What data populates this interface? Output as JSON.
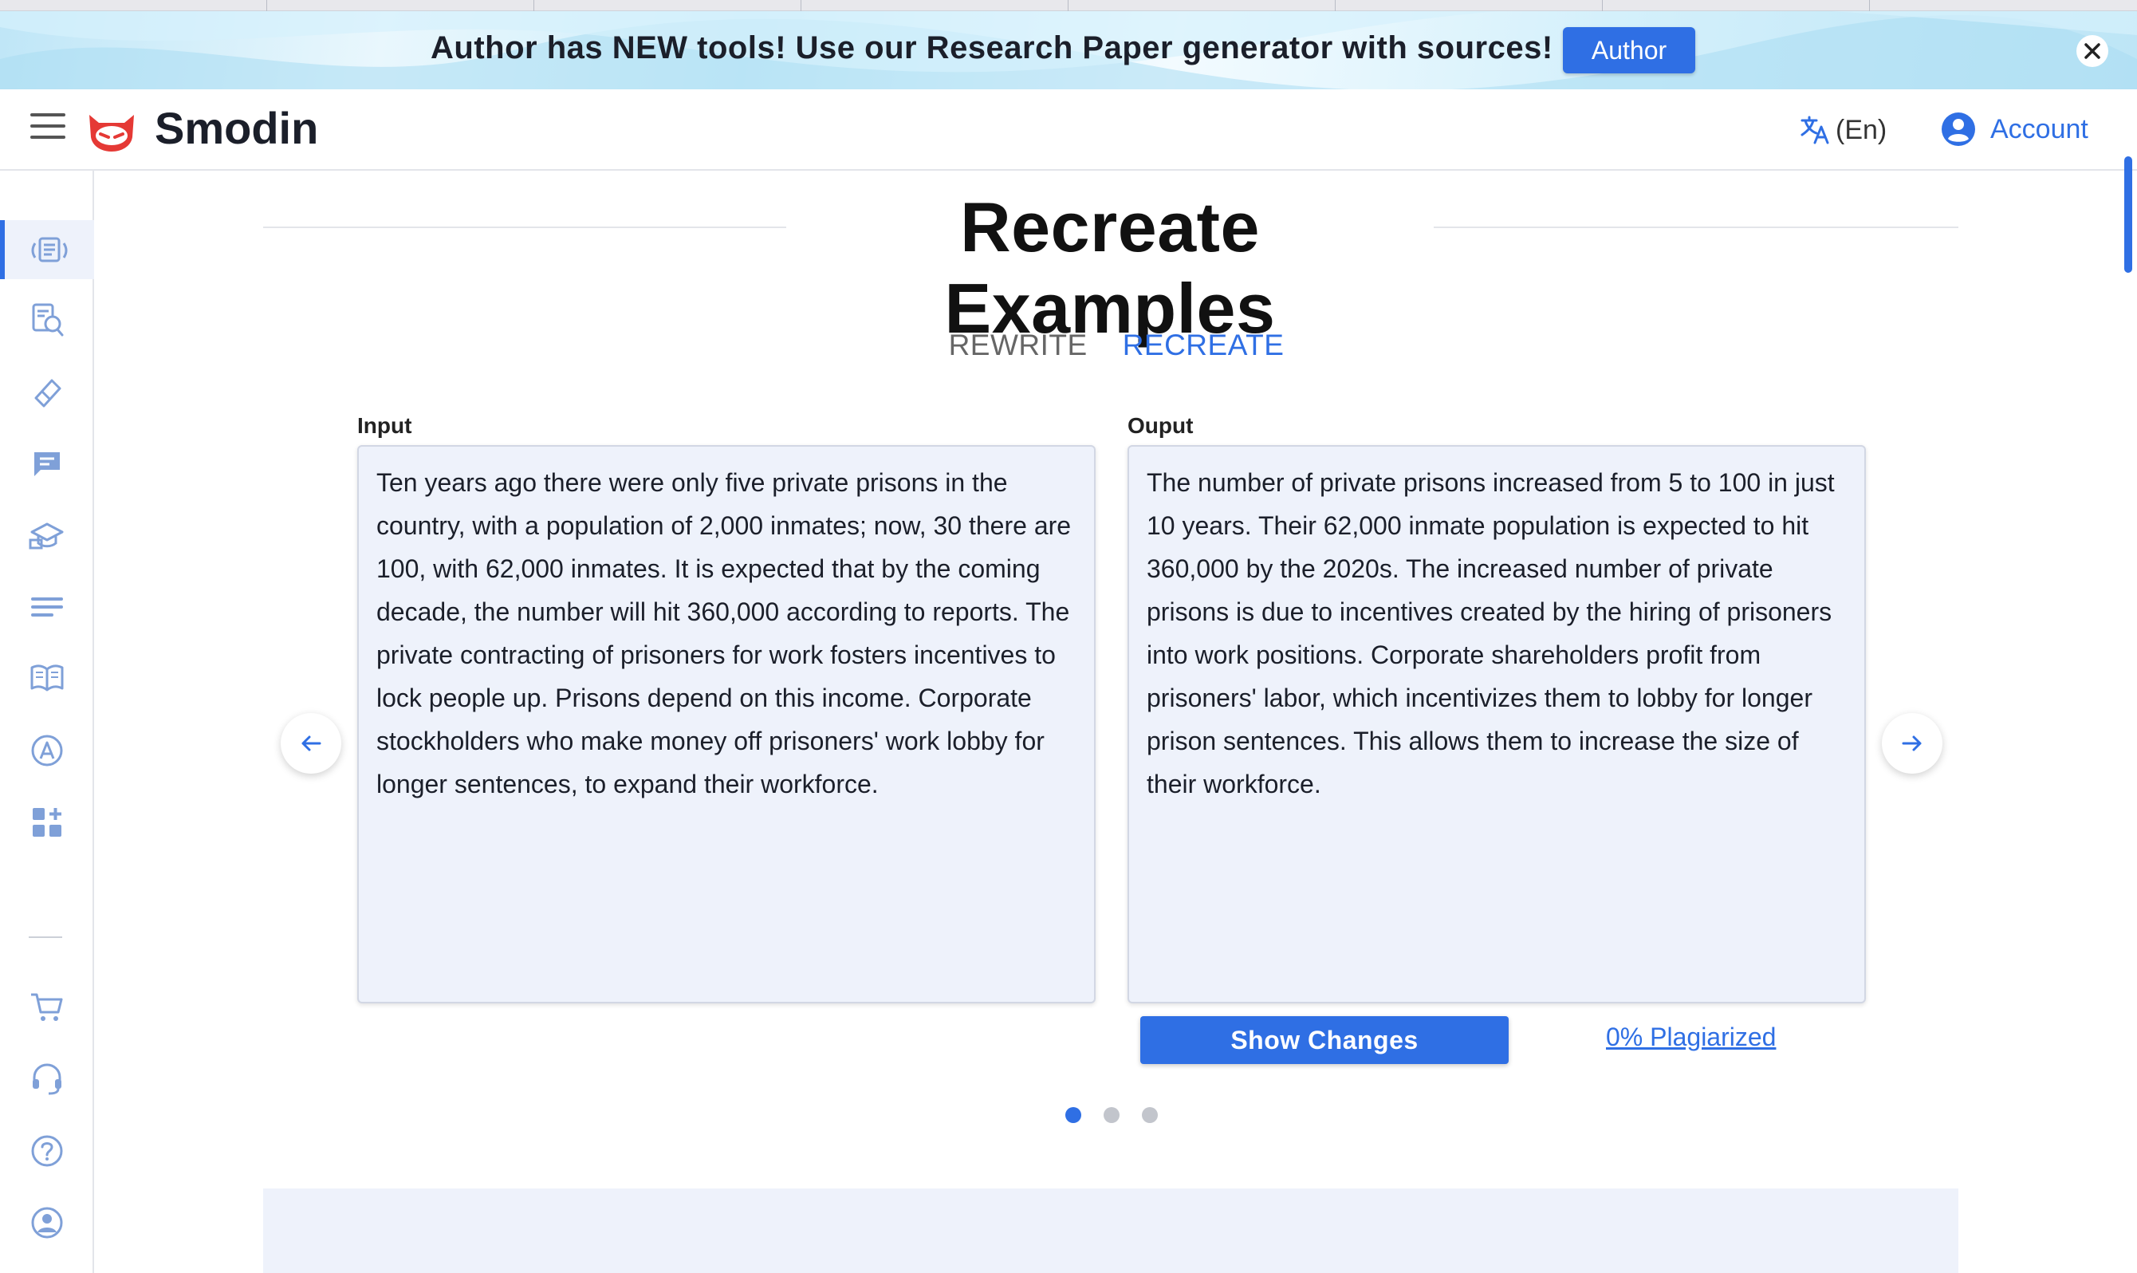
{
  "banner": {
    "text": "Author has NEW tools! Use our Research Paper generator with sources!",
    "button_label": "Author",
    "close_icon": "close-icon"
  },
  "header": {
    "brand": "Smodin",
    "language_label": "(En)",
    "account_label": "Account",
    "icons": [
      "menu-icon",
      "smodin-logo",
      "translate-icon",
      "account-circle-icon"
    ]
  },
  "sidebar": {
    "items": [
      {
        "icon": "rewriter-icon",
        "active": true
      },
      {
        "icon": "plagiarism-checker-icon"
      },
      {
        "icon": "eraser-icon"
      },
      {
        "icon": "chat-icon"
      },
      {
        "icon": "graduation-cap-icon"
      },
      {
        "icon": "summarizer-lines-icon"
      },
      {
        "icon": "book-icon"
      },
      {
        "icon": "grammar-a-icon"
      },
      {
        "icon": "add-apps-icon"
      },
      {
        "icon": "cart-icon"
      },
      {
        "icon": "headset-icon"
      },
      {
        "icon": "help-icon"
      },
      {
        "icon": "profile-icon"
      }
    ]
  },
  "main": {
    "title": "Recreate Examples",
    "tabs": [
      {
        "label": "REWRITE",
        "active": false
      },
      {
        "label": "RECREATE",
        "active": true
      }
    ],
    "input_label": "Input",
    "output_label": "Ouput",
    "input_text": "Ten years ago there were only five private prisons in the country, with a population of 2,000 inmates; now, 30 there are 100, with 62,000 inmates. It is expected that by the coming decade, the number will hit 360,000 according to reports. The private contracting of prisoners for work fosters incentives to lock people up. Prisons depend on this income. Corporate stockholders who make money off prisoners' work lobby for longer sentences, to expand their workforce.",
    "output_text": "The number of private prisons increased from 5 to 100 in just 10 years. Their 62,000 inmate population is expected to hit 360,000 by the 2020s. The increased number of private prisons is due to incentives created by the hiring of prisoners into work positions. Corporate shareholders profit from prisoners' labor, which incentivizes them to lobby for longer prison sentences. This allows them to increase the size of their workforce.",
    "show_changes_label": "Show Changes",
    "plagiarized_label": "0% Plagiarized",
    "carousel": {
      "count": 3,
      "active_index": 0
    }
  },
  "colors": {
    "accent": "#2f6fe4",
    "panel_bg": "#eef2fb",
    "logo_red": "#e53935"
  }
}
